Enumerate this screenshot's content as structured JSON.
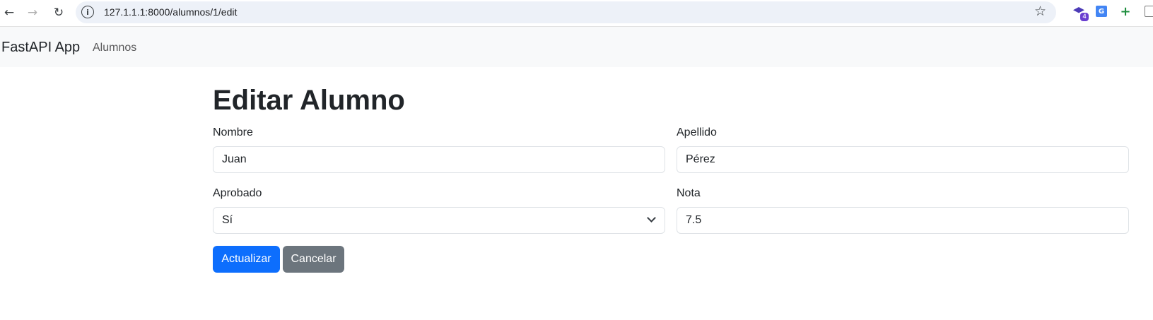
{
  "browser": {
    "url": "127.1.1.1:8000/alumnos/1/edit",
    "icons": {
      "back": "back-arrow-icon",
      "forward": "forward-arrow-icon",
      "reload": "reload-icon",
      "site_info": "info-icon",
      "bookmark": "star-icon"
    },
    "extensions": {
      "cap_badge": "4"
    }
  },
  "navbar": {
    "brand": "FastAPI App",
    "links": [
      "Alumnos"
    ]
  },
  "page": {
    "title": "Editar Alumno"
  },
  "form": {
    "nombre": {
      "label": "Nombre",
      "value": "Juan"
    },
    "apellido": {
      "label": "Apellido",
      "value": "Pérez"
    },
    "aprobado": {
      "label": "Aprobado",
      "value": "Sí"
    },
    "nota": {
      "label": "Nota",
      "value": "7.5"
    }
  },
  "actions": {
    "update_label": "Actualizar",
    "cancel_label": "Cancelar"
  },
  "colors": {
    "primary": "#0d6efd",
    "secondary": "#6c757d",
    "navbar_bg": "#f8f9fa"
  }
}
